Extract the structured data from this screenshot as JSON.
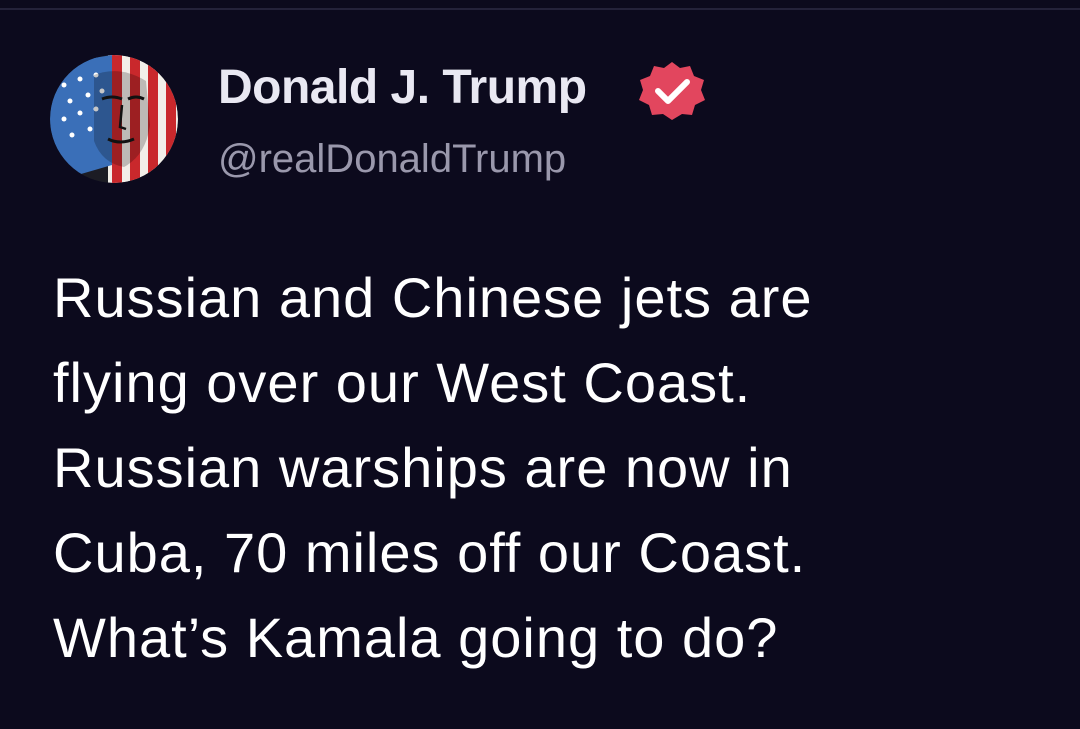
{
  "post": {
    "author": {
      "display_name": "Donald J. Trump",
      "handle": "@realDonaldTrump",
      "verified_icon": "verified-badge-icon",
      "avatar_icon": "flag-portrait-avatar"
    },
    "body_lines": [
      "Russian and Chinese jets are",
      "flying over our West Coast.",
      "Russian warships are now in",
      "Cuba, 70 miles off our Coast.",
      "What’s Kamala going to do?"
    ]
  },
  "colors": {
    "background": "#0c0a1d",
    "display_name": "#e9e8f2",
    "handle": "#9a98ac",
    "body_text": "#ffffff",
    "verified_badge": "#e2465e"
  }
}
